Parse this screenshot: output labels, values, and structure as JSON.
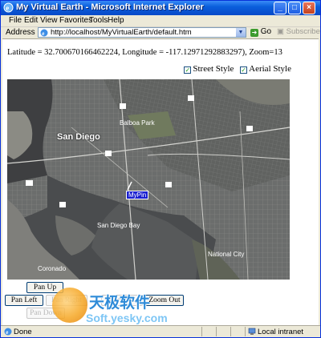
{
  "window": {
    "title": "My Virtual Earth - Microsoft Internet Explorer",
    "controls": {
      "minimize": "_",
      "maximize": "□",
      "close": "×"
    }
  },
  "menu": {
    "items": [
      {
        "label": "File",
        "accel": "F"
      },
      {
        "label": "Edit",
        "accel": "E"
      },
      {
        "label": "View",
        "accel": "V"
      },
      {
        "label": "Favorites",
        "accel": "a"
      },
      {
        "label": "Tools",
        "accel": "T"
      },
      {
        "label": "Help",
        "accel": "H"
      }
    ]
  },
  "address": {
    "label": "Address",
    "url": "http://localhost/MyVirtualEarth/default.htm",
    "go_label": "Go",
    "subscribe_label": "Subscribe"
  },
  "page": {
    "coordinates": "Latitude = 32.700670166462224, Longitude = -117.12971292883297), Zoom=13",
    "street_style": "Street Style",
    "aerial_style": "Aerial Style",
    "street_checked": true,
    "aerial_checked": true
  },
  "map": {
    "city_label": "San Diego",
    "pin_label": "MyPin",
    "place_labels": [
      "National City",
      "Coronado",
      "Balboa Park",
      "San Diego Bay"
    ],
    "highway_shields": [
      "5",
      "163",
      "805",
      "94",
      "15",
      "282",
      "75"
    ]
  },
  "buttons": {
    "pan_up": "Pan Up",
    "pan_left": "Pan Left",
    "pan_right": "Pan Right",
    "pan_down": "Pan Down",
    "zoom_in": "Zoom In",
    "zoom_out": "Zoom Out"
  },
  "watermark": {
    "cn_text": "天极软件",
    "url_text": "Soft.yesky.com"
  },
  "status": {
    "text": "Done",
    "zone": "Local intranet"
  },
  "colors": {
    "title_bar": "#0a5fdc",
    "pin": "#1a20d0",
    "watermark_blue": "#2e8bd8"
  }
}
